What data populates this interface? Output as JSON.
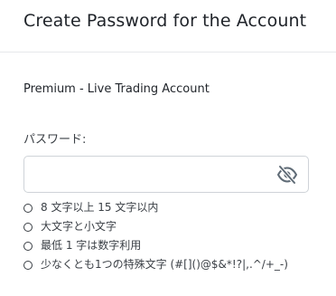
{
  "header": {
    "title": "Create Password for the Account"
  },
  "account": {
    "name": "Premium - Live Trading Account"
  },
  "password_field": {
    "label": "パスワード:",
    "value": "",
    "placeholder": "",
    "toggle_icon": "eye-slash-icon",
    "icon_color": "#5f6b76"
  },
  "requirements": [
    {
      "text": "8 文字以上 15 文字以内",
      "icon": "circle-outline-icon"
    },
    {
      "text": "大文字と小文字",
      "icon": "circle-outline-icon"
    },
    {
      "text": "最低 1 字は数字利用",
      "icon": "circle-outline-icon"
    },
    {
      "text": "少なくとも1つの特殊文字 (#[]()@$&*!?|,.^/+_-)",
      "icon": "circle-outline-icon"
    }
  ],
  "colors": {
    "text": "#1f2329",
    "border": "#cfd3d8",
    "divider": "#e6e8eb"
  }
}
